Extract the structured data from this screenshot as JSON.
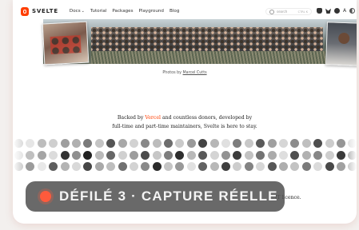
{
  "nav": {
    "logo_text": "SVELTE",
    "links": [
      {
        "label": "Docs",
        "caret": "⌄"
      },
      {
        "label": "Tutorial"
      },
      {
        "label": "Packages"
      },
      {
        "label": "Playground"
      },
      {
        "label": "Blog"
      }
    ],
    "search_placeholder": "search",
    "search_shortcut": "CTRL K",
    "lang_label": "A",
    "icons": [
      "discord-icon",
      "bluesky-icon",
      "github-icon",
      "language-icon",
      "theme-toggle-icon"
    ]
  },
  "hero": {
    "credit_prefix": "Photos by",
    "credit_link": "Marcel Cutts"
  },
  "backers": {
    "line1_before": "Backed by",
    "line1_link": "Vercel",
    "line1_after": "and countless donors, developed by",
    "line2": "full-time and part-time maintainers, Svelte is here to stay."
  },
  "donor_colors": [
    [
      "#d8d8d8",
      "#e6e6e6",
      "#bdbdbd",
      "#cfcfcf",
      "#9e9e9e",
      "#b0b0b0",
      "#7a7a7a",
      "#c4c4c4",
      "#555555",
      "#a8a8a8",
      "#d2d2d2",
      "#888888",
      "#bcbcbc",
      "#6d6d6d",
      "#cacaca",
      "#9a9a9a",
      "#444444",
      "#b6b6b6",
      "#e0e0e0",
      "#7d7d7d",
      "#c8c8c8",
      "#5a5a5a",
      "#a0a0a0",
      "#d6d6d6",
      "#8c8c8c",
      "#bfbfbf",
      "#4e4e4e",
      "#cccccc",
      "#969696",
      "#dadada",
      "#777777",
      "#b3b3b3"
    ],
    [
      "#e2e2e2",
      "#c0c0c0",
      "#a5a5a5",
      "#dcdcdc",
      "#333333",
      "#8f8f8f",
      "#222222",
      "#bababa",
      "#666666",
      "#d0d0d0",
      "#9c9c9c",
      "#4a4a4a",
      "#c6c6c6",
      "#7e7e7e",
      "#2e2e2e",
      "#b9b9b9",
      "#595959",
      "#d4d4d4",
      "#929292",
      "#3c3c3c",
      "#c2c2c2",
      "#737373",
      "#ababab",
      "#dedede",
      "#505050",
      "#b1b1b1",
      "#868686",
      "#cecece",
      "#3a3a3a",
      "#a3a3a3",
      "#e4e4e4",
      "#6a6a6a"
    ],
    [
      "#c9c9c9",
      "#9b9b9b",
      "#e8e8e8",
      "#5e5e5e",
      "#b4b4b4",
      "#d9d9d9",
      "#474747",
      "#a9a9a9",
      "#bebebe",
      "#707070",
      "#d3d3d3",
      "#8a8a8a",
      "#2b2b2b",
      "#c5c5c5",
      "#999999",
      "#e1e1e1",
      "#626262",
      "#b8b8b8",
      "#3f3f3f",
      "#cdcdcd",
      "#838383",
      "#d7d7d7",
      "#575757",
      "#aeaeae",
      "#c3c3c3",
      "#7b7b7b",
      "#dbdbdb",
      "#494949",
      "#a1a1a1",
      "#bbbbbb",
      "#686868",
      "#d1d1d1"
    ]
  ],
  "tail_text": "...IT licence.",
  "overlay": {
    "caption": "DÉFILÉ 3 · CAPTURE RÉELLE",
    "dot_color": "#ff5a3c"
  },
  "colors": {
    "brand": "#ff3e00",
    "page_background": "#f3f0ee"
  }
}
